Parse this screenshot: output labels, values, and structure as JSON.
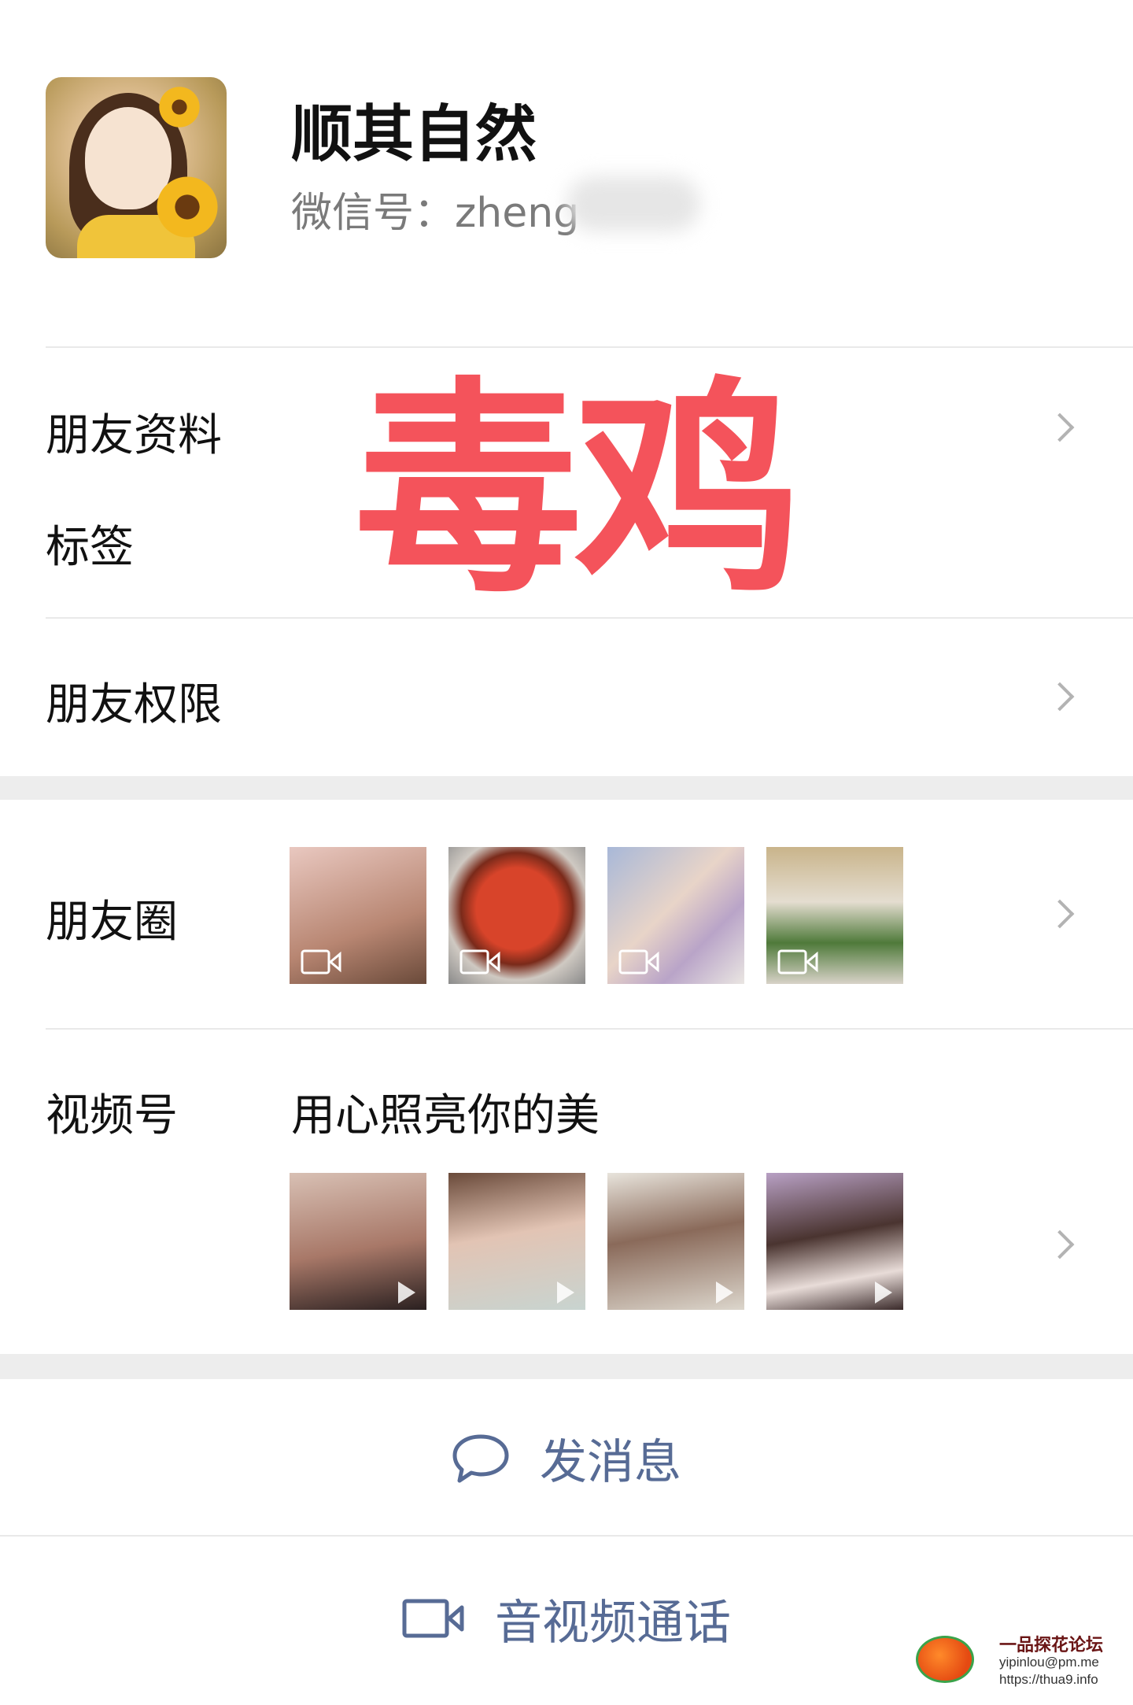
{
  "profile": {
    "name": "顺其自然",
    "wechat_id": "微信号：zheng"
  },
  "rows": {
    "friend_info": "朋友资料",
    "tags": "标签",
    "permissions": "朋友权限",
    "moments": "朋友圈",
    "channels": "视频号",
    "channels_desc": "用心照亮你的美"
  },
  "overlay_text": "毒鸡",
  "actions": {
    "message": "发消息",
    "call": "音视频通话"
  },
  "watermark": {
    "forum_name": "一品探花论坛",
    "email": "yipinlou@pm.me",
    "url": "https://thua9.info"
  },
  "colors": {
    "link": "#576b95",
    "overlay": "#f4535b",
    "section_gap": "#ededed"
  }
}
